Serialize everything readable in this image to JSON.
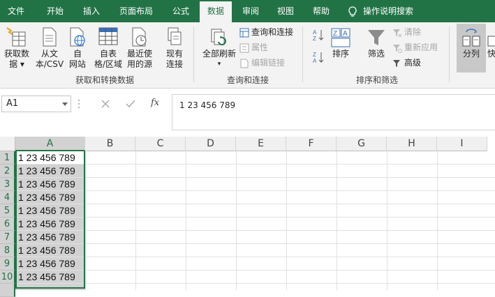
{
  "tabs": [
    {
      "label": "文件",
      "active": false
    },
    {
      "label": "开始",
      "active": false
    },
    {
      "label": "插入",
      "active": false
    },
    {
      "label": "页面布局",
      "active": false
    },
    {
      "label": "公式",
      "active": false
    },
    {
      "label": "数据",
      "active": true
    },
    {
      "label": "审阅",
      "active": false
    },
    {
      "label": "视图",
      "active": false
    },
    {
      "label": "帮助",
      "active": false
    }
  ],
  "tell_me": "操作说明搜索",
  "ribbon": {
    "get_data": {
      "line1": "获取数",
      "line2": "据 ▾"
    },
    "from_text": {
      "line1": "从文",
      "line2": "本/CSV"
    },
    "from_web": {
      "line1": "自",
      "line2": "网站"
    },
    "from_table": {
      "line1": "自表",
      "line2": "格/区域"
    },
    "recent": {
      "line1": "最近使",
      "line2": "用的源"
    },
    "existing": {
      "line1": "现有",
      "line2": "连接"
    },
    "group1": "获取和转换数据",
    "refresh_all": {
      "line1": "全部刷新",
      "line2": "▾"
    },
    "queries": "查询和连接",
    "properties": "属性",
    "edit_links": "编辑链接",
    "group2": "查询和连接",
    "sort": "排序",
    "filter": "筛选",
    "clear": "清除",
    "reapply": "重新应用",
    "advanced": "高级",
    "group3": "排序和筛选",
    "text_to_columns": "分列",
    "flash_fill": "快"
  },
  "formula_bar": {
    "name_box": "A1",
    "fx_label": "fx",
    "content": "1 23 456 789"
  },
  "sheet": {
    "columns": [
      "A",
      "B",
      "C",
      "D",
      "E",
      "F",
      "G",
      "H",
      "I"
    ],
    "rows": [
      "1",
      "2",
      "3",
      "4",
      "5",
      "6",
      "7",
      "8",
      "9",
      "10"
    ],
    "cells": [
      "1 23 456 789",
      "1 23 456 789",
      "1 23 456 789",
      "1 23 456 789",
      "1 23 456 789",
      "1 23 456 789",
      "1 23 456 789",
      "1 23 456 789",
      "1 23 456 789",
      "1 23 456 789"
    ]
  },
  "colors": {
    "accent": "#217346",
    "selection": "#d2d2d2"
  }
}
